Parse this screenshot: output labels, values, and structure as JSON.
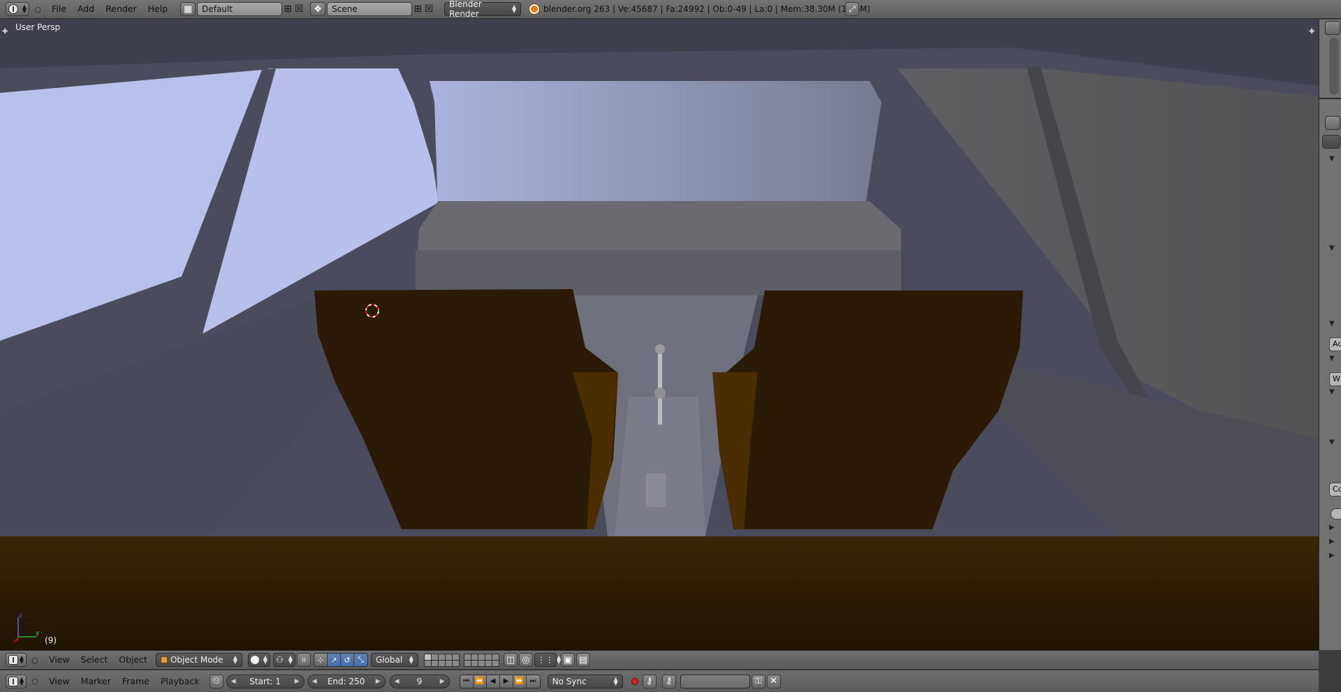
{
  "top_bar": {
    "menus": [
      "File",
      "Add",
      "Render",
      "Help"
    ],
    "screen_layout": "Default",
    "scene": "Scene",
    "render_engine": "Blender Render",
    "stats": "blender.org 263 | Ve:45687 | Fa:24992 | Ob:0-49 | La:0 | Mem:38.30M (1.16M)"
  },
  "viewport": {
    "view_label": "User Persp",
    "frame_indicator": "(9)",
    "axis_labels": {
      "x": "x",
      "y": "y",
      "z": "z"
    },
    "colors": {
      "sky": "#b7c1ea",
      "interior": "#4b4d5e",
      "seat": "#2a1a05",
      "seat_side": "#4a2c00",
      "dashboard": "#2a1b05",
      "console": "#6e7080"
    }
  },
  "view_header": {
    "menus": [
      "View",
      "Select",
      "Object"
    ],
    "mode": "Object Mode",
    "orientation": "Global"
  },
  "timeline_header": {
    "menus": [
      "View",
      "Marker",
      "Frame",
      "Playback"
    ],
    "start": "Start: 1",
    "end": "End: 250",
    "current_frame": "9",
    "sync": "No Sync"
  },
  "right_strip": {
    "field_texts": [
      "Ad",
      "W",
      "Co"
    ]
  }
}
